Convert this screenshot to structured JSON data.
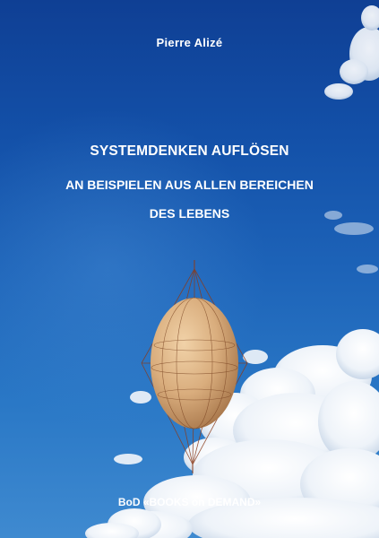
{
  "cover": {
    "author": "Pierre Alizé",
    "title": "SYSTEMDENKEN AUFLÖSEN",
    "subtitle_line1": "AN BEISPIELEN AUS ALLEN BEREICHEN",
    "subtitle_line2": "DES LEBENS",
    "publisher": "BoD «BOOKS on DEMAND»"
  },
  "colors": {
    "sky_top": "#0f3f94",
    "sky_bottom": "#3f8ad0",
    "text": "#ffffff",
    "egg": "#d9b184",
    "wire": "#8a3b1a"
  }
}
